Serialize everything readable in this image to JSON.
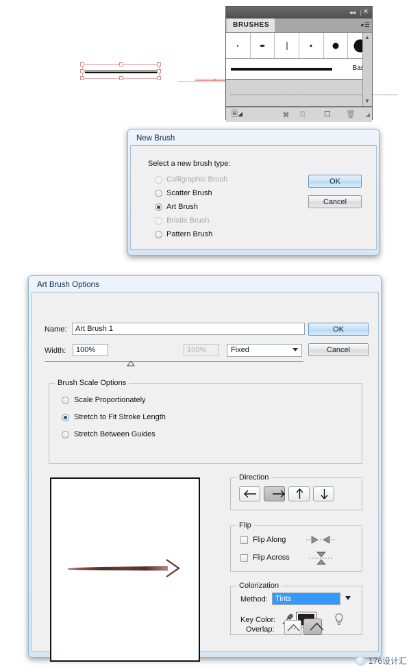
{
  "brushes_panel": {
    "tab_label": "BRUSHES",
    "collapse_icon": "collapse-double-arrow-icon",
    "close_icon": "close-icon",
    "menu_icon": "panel-menu-icon",
    "swatches": [
      {
        "name": "brush-swatch-dot-tiny",
        "size": 2
      },
      {
        "name": "brush-swatch-oval-small",
        "size": 5
      },
      {
        "name": "brush-swatch-thin-line",
        "size": 1
      },
      {
        "name": "brush-swatch-dot-small",
        "size": 3
      },
      {
        "name": "brush-swatch-dot-medium",
        "size": 8
      },
      {
        "name": "brush-swatch-dot-large",
        "size": 17
      }
    ],
    "basic_stroke_label": "Basic",
    "art_brush_preview": "~~~~~~~~~~~~~~~~~~~~~~~~~~~~~~~~~~~~~~~~~~~",
    "footer_icons": [
      "brush-libraries-icon",
      "remove-brush-link-icon",
      "options-of-selected-object-icon",
      "new-brush-icon",
      "delete-brush-icon",
      "resize-grip-icon"
    ],
    "scrollbar": {
      "up_icon": "scroll-up-arrow-icon",
      "down_icon": "scroll-down-arrow-icon"
    }
  },
  "new_brush_dialog": {
    "title": "New Brush",
    "prompt": "Select a new brush type:",
    "options": [
      {
        "label": "Calligraphic Brush",
        "selected": false,
        "disabled": true
      },
      {
        "label": "Scatter Brush",
        "selected": false,
        "disabled": false
      },
      {
        "label": "Art Brush",
        "selected": true,
        "disabled": false
      },
      {
        "label": "Bristle Brush",
        "selected": false,
        "disabled": true
      },
      {
        "label": "Pattern Brush",
        "selected": false,
        "disabled": false
      }
    ],
    "ok_label": "OK",
    "cancel_label": "Cancel"
  },
  "art_brush_options": {
    "title": "Art Brush Options",
    "name_label": "Name:",
    "name_value": "Art Brush 1",
    "width_label": "Width:",
    "width_value": "100%",
    "width_secondary_value": "100%",
    "width_mode": "Fixed",
    "ok_label": "OK",
    "cancel_label": "Cancel",
    "brush_scale": {
      "legend": "Brush Scale Options",
      "options": [
        {
          "label": "Scale Proportionately",
          "selected": false
        },
        {
          "label": "Stretch to Fit Stroke Length",
          "selected": true
        },
        {
          "label": "Stretch Between Guides",
          "selected": false
        }
      ]
    },
    "direction": {
      "legend": "Direction",
      "buttons": [
        {
          "name": "direction-left-button",
          "icon": "arrow-left-icon",
          "selected": false
        },
        {
          "name": "direction-right-button",
          "icon": "arrow-right-icon",
          "selected": true
        },
        {
          "name": "direction-up-button",
          "icon": "arrow-up-icon",
          "selected": false
        },
        {
          "name": "direction-down-button",
          "icon": "arrow-down-icon",
          "selected": false
        }
      ]
    },
    "flip": {
      "legend": "Flip",
      "along_label": "Flip Along",
      "along_checked": false,
      "across_label": "Flip Across",
      "across_checked": false
    },
    "colorization": {
      "legend": "Colorization",
      "method_label": "Method:",
      "method_value": "Tints",
      "key_color_label": "Key Color:",
      "key_color_hex": "#231f20",
      "eyedropper_icon": "eyedropper-icon",
      "tips_icon": "lightbulb-tips-icon"
    },
    "overlap": {
      "label": "Overlap:",
      "buttons": [
        {
          "name": "overlap-allowed-button",
          "icon": "overlap-allowed-icon",
          "selected": false
        },
        {
          "name": "overlap-not-allowed-button",
          "icon": "overlap-not-allowed-icon",
          "selected": true
        }
      ]
    },
    "preview": {
      "name": "brush-preview-stroke",
      "stroke_color": "#6b3a36"
    }
  },
  "watermark": {
    "text": "176设计汇",
    "icon": "watermark-badge-icon"
  },
  "colors": {
    "dialog_frame": "#8fb4d4",
    "dialog_client": "#f0f0f0",
    "primary_button_border": "#5f98c8",
    "selected_highlight": "#3399ff",
    "panel_dark": "#5c5c5c"
  }
}
